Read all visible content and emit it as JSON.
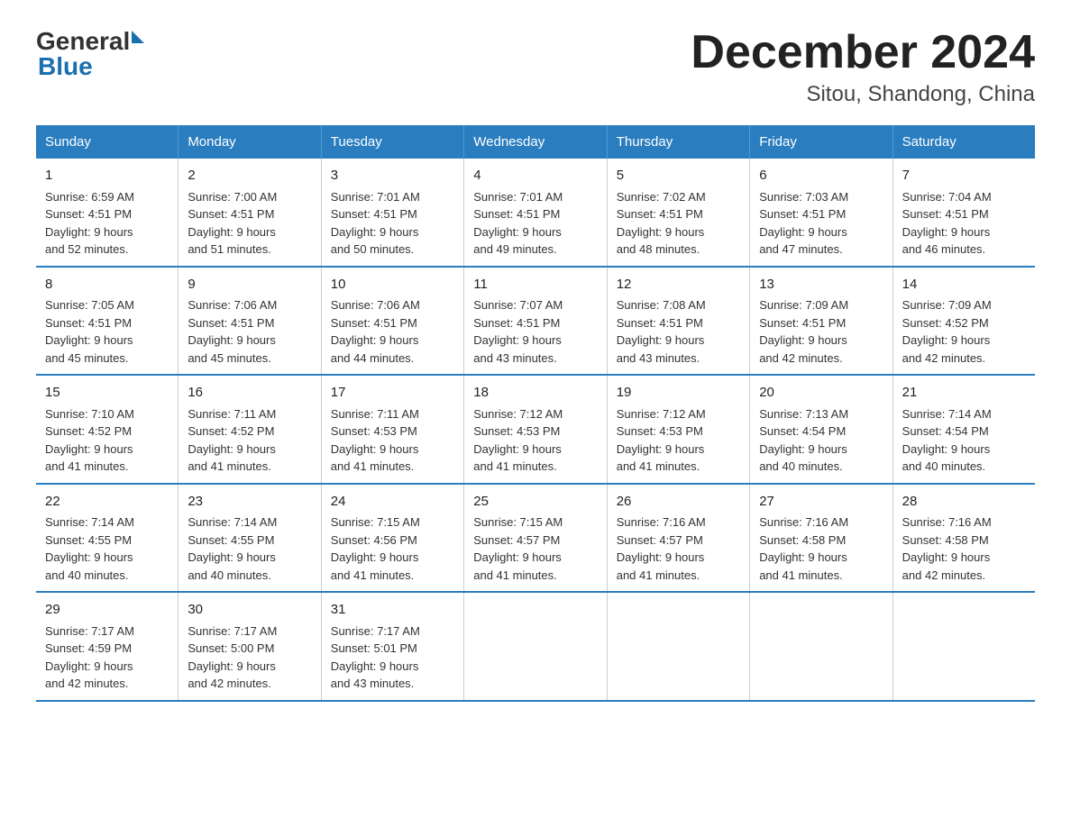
{
  "logo": {
    "general": "General",
    "blue": "Blue"
  },
  "title": "December 2024",
  "subtitle": "Sitou, Shandong, China",
  "headers": [
    "Sunday",
    "Monday",
    "Tuesday",
    "Wednesday",
    "Thursday",
    "Friday",
    "Saturday"
  ],
  "weeks": [
    [
      {
        "day": "1",
        "info": "Sunrise: 6:59 AM\nSunset: 4:51 PM\nDaylight: 9 hours\nand 52 minutes."
      },
      {
        "day": "2",
        "info": "Sunrise: 7:00 AM\nSunset: 4:51 PM\nDaylight: 9 hours\nand 51 minutes."
      },
      {
        "day": "3",
        "info": "Sunrise: 7:01 AM\nSunset: 4:51 PM\nDaylight: 9 hours\nand 50 minutes."
      },
      {
        "day": "4",
        "info": "Sunrise: 7:01 AM\nSunset: 4:51 PM\nDaylight: 9 hours\nand 49 minutes."
      },
      {
        "day": "5",
        "info": "Sunrise: 7:02 AM\nSunset: 4:51 PM\nDaylight: 9 hours\nand 48 minutes."
      },
      {
        "day": "6",
        "info": "Sunrise: 7:03 AM\nSunset: 4:51 PM\nDaylight: 9 hours\nand 47 minutes."
      },
      {
        "day": "7",
        "info": "Sunrise: 7:04 AM\nSunset: 4:51 PM\nDaylight: 9 hours\nand 46 minutes."
      }
    ],
    [
      {
        "day": "8",
        "info": "Sunrise: 7:05 AM\nSunset: 4:51 PM\nDaylight: 9 hours\nand 45 minutes."
      },
      {
        "day": "9",
        "info": "Sunrise: 7:06 AM\nSunset: 4:51 PM\nDaylight: 9 hours\nand 45 minutes."
      },
      {
        "day": "10",
        "info": "Sunrise: 7:06 AM\nSunset: 4:51 PM\nDaylight: 9 hours\nand 44 minutes."
      },
      {
        "day": "11",
        "info": "Sunrise: 7:07 AM\nSunset: 4:51 PM\nDaylight: 9 hours\nand 43 minutes."
      },
      {
        "day": "12",
        "info": "Sunrise: 7:08 AM\nSunset: 4:51 PM\nDaylight: 9 hours\nand 43 minutes."
      },
      {
        "day": "13",
        "info": "Sunrise: 7:09 AM\nSunset: 4:51 PM\nDaylight: 9 hours\nand 42 minutes."
      },
      {
        "day": "14",
        "info": "Sunrise: 7:09 AM\nSunset: 4:52 PM\nDaylight: 9 hours\nand 42 minutes."
      }
    ],
    [
      {
        "day": "15",
        "info": "Sunrise: 7:10 AM\nSunset: 4:52 PM\nDaylight: 9 hours\nand 41 minutes."
      },
      {
        "day": "16",
        "info": "Sunrise: 7:11 AM\nSunset: 4:52 PM\nDaylight: 9 hours\nand 41 minutes."
      },
      {
        "day": "17",
        "info": "Sunrise: 7:11 AM\nSunset: 4:53 PM\nDaylight: 9 hours\nand 41 minutes."
      },
      {
        "day": "18",
        "info": "Sunrise: 7:12 AM\nSunset: 4:53 PM\nDaylight: 9 hours\nand 41 minutes."
      },
      {
        "day": "19",
        "info": "Sunrise: 7:12 AM\nSunset: 4:53 PM\nDaylight: 9 hours\nand 41 minutes."
      },
      {
        "day": "20",
        "info": "Sunrise: 7:13 AM\nSunset: 4:54 PM\nDaylight: 9 hours\nand 40 minutes."
      },
      {
        "day": "21",
        "info": "Sunrise: 7:14 AM\nSunset: 4:54 PM\nDaylight: 9 hours\nand 40 minutes."
      }
    ],
    [
      {
        "day": "22",
        "info": "Sunrise: 7:14 AM\nSunset: 4:55 PM\nDaylight: 9 hours\nand 40 minutes."
      },
      {
        "day": "23",
        "info": "Sunrise: 7:14 AM\nSunset: 4:55 PM\nDaylight: 9 hours\nand 40 minutes."
      },
      {
        "day": "24",
        "info": "Sunrise: 7:15 AM\nSunset: 4:56 PM\nDaylight: 9 hours\nand 41 minutes."
      },
      {
        "day": "25",
        "info": "Sunrise: 7:15 AM\nSunset: 4:57 PM\nDaylight: 9 hours\nand 41 minutes."
      },
      {
        "day": "26",
        "info": "Sunrise: 7:16 AM\nSunset: 4:57 PM\nDaylight: 9 hours\nand 41 minutes."
      },
      {
        "day": "27",
        "info": "Sunrise: 7:16 AM\nSunset: 4:58 PM\nDaylight: 9 hours\nand 41 minutes."
      },
      {
        "day": "28",
        "info": "Sunrise: 7:16 AM\nSunset: 4:58 PM\nDaylight: 9 hours\nand 42 minutes."
      }
    ],
    [
      {
        "day": "29",
        "info": "Sunrise: 7:17 AM\nSunset: 4:59 PM\nDaylight: 9 hours\nand 42 minutes."
      },
      {
        "day": "30",
        "info": "Sunrise: 7:17 AM\nSunset: 5:00 PM\nDaylight: 9 hours\nand 42 minutes."
      },
      {
        "day": "31",
        "info": "Sunrise: 7:17 AM\nSunset: 5:01 PM\nDaylight: 9 hours\nand 43 minutes."
      },
      {
        "day": "",
        "info": ""
      },
      {
        "day": "",
        "info": ""
      },
      {
        "day": "",
        "info": ""
      },
      {
        "day": "",
        "info": ""
      }
    ]
  ]
}
